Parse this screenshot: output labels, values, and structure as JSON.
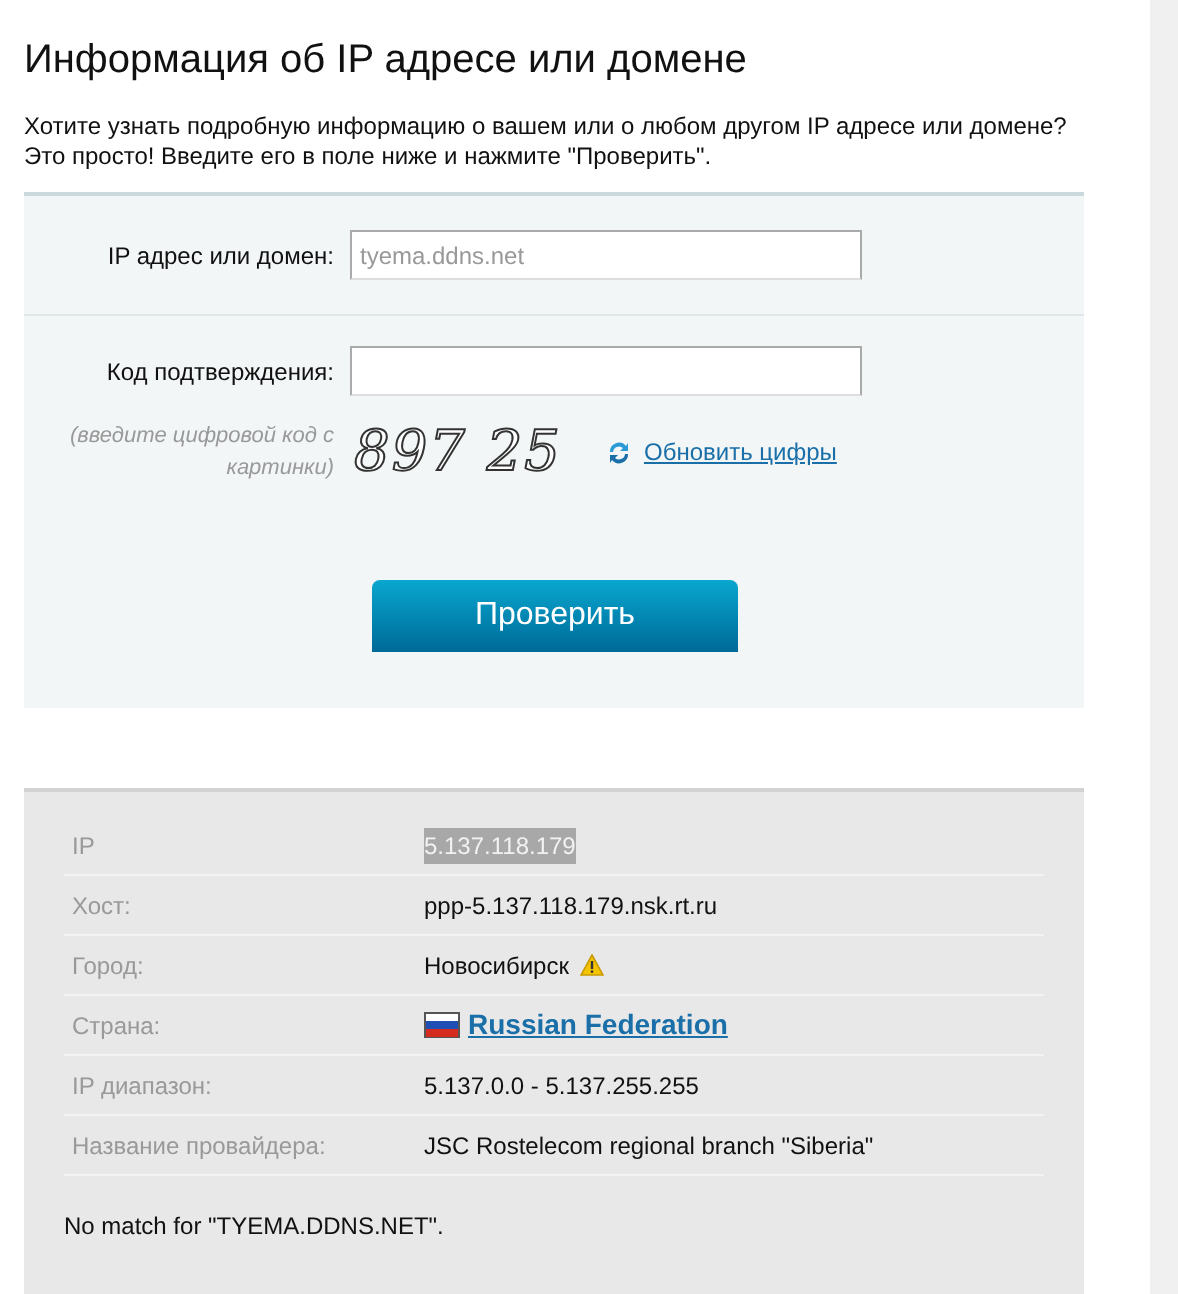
{
  "title": "Информация об IP адресе или домене",
  "intro": "Хотите узнать подробную информацию о вашем или о любом другом IP адресе или домене? Это просто! Введите его в поле ниже и нажмите \"Проверить\".",
  "form": {
    "domain_label": "IP адрес или домен:",
    "domain_placeholder": "tyema.ddns.net",
    "code_label": "Код подтверждения:",
    "code_hint": "(введите цифровой код с картинки)",
    "captcha": "897 25",
    "refresh_link": "Обновить цифры",
    "submit": "Проверить"
  },
  "results": [
    {
      "label": "IP",
      "value": "5.137.118.179",
      "kind": "selected"
    },
    {
      "label": "Хост:",
      "value": "ppp-5.137.118.179.nsk.rt.ru",
      "kind": "text"
    },
    {
      "label": "Город:",
      "value": "Новосибирск",
      "kind": "warning"
    },
    {
      "label": "Страна:",
      "value": "Russian Federation",
      "kind": "flag-link"
    },
    {
      "label": "IP диапазон:",
      "value": "5.137.0.0 - 5.137.255.255",
      "kind": "text"
    },
    {
      "label": "Название провайдера:",
      "value": "JSC Rostelecom regional branch \"Siberia\"",
      "kind": "text"
    }
  ],
  "message": "No match for \"TYEMA.DDNS.NET\"."
}
